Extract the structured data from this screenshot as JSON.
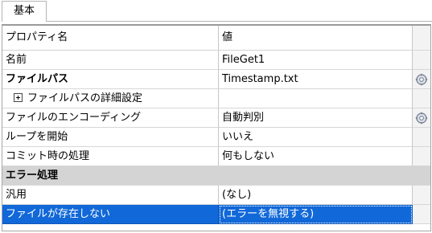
{
  "tab": {
    "label": "基本"
  },
  "header": {
    "name": "プロパティ名",
    "value": "値"
  },
  "rows": [
    {
      "name": "名前",
      "value": "FileGet1"
    },
    {
      "name": "ファイルパス",
      "value": "Timestamp.txt",
      "gear": "gear-icon"
    },
    {
      "name": "ファイルパスの詳細設定",
      "value": "",
      "expander": "plus-box-icon"
    },
    {
      "name": "ファイルのエンコーディング",
      "value": "自動判別",
      "gear": "gear-icon"
    },
    {
      "name": "ループを開始",
      "value": "いいえ"
    },
    {
      "name": "コミット時の処理",
      "value": "何もしない"
    },
    {
      "name": "エラー処理",
      "value": ""
    },
    {
      "name": "汎用",
      "value": "(なし)"
    },
    {
      "name": "ファイルが存在しない",
      "value": "(エラーを無視する)"
    }
  ],
  "colors": {
    "selection": "#1168d8",
    "section": "#d4d4d4",
    "border": "#a7a7a7"
  }
}
